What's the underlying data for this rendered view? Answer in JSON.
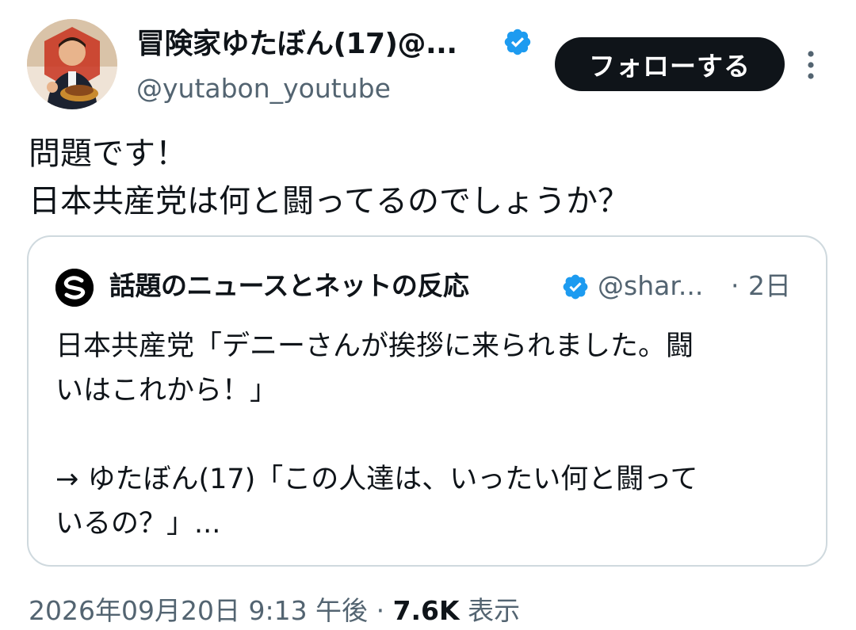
{
  "author": {
    "display_name": "冒険家ゆたぼん(17)@...",
    "handle": "@yutabon_youtube",
    "avatar_icon": "user-avatar",
    "verified_color": "#1d9bf0"
  },
  "actions": {
    "follow_label": "フォローする",
    "more_icon": "more-vertical-icon"
  },
  "tweet": {
    "lines": [
      "問題です！",
      "日本共産党は何と闘ってるのでしょうか？"
    ]
  },
  "quote": {
    "display_name": "話題のニュースとネットの反応",
    "handle": "@shar...",
    "separator": "·",
    "time": "2日",
    "avatar_icon": "s-logo-icon",
    "body": {
      "line1": "日本共産党「デニーさんが挨拶に来られました。闘",
      "line2": "いはこれから！」",
      "line3": "→ ゆたぼん(17)「この人達は、いったい何と闘って",
      "line4": "いるの？」..."
    }
  },
  "meta": {
    "timestamp": "2026年09月20日 9:13 午後",
    "separator": "·",
    "views_count": "7.6K",
    "views_label": "表示"
  },
  "colors": {
    "text": "#0f1419",
    "secondary": "#536471",
    "border": "#cfd9de",
    "button_bg": "#0f1419",
    "verified": "#1d9bf0"
  }
}
